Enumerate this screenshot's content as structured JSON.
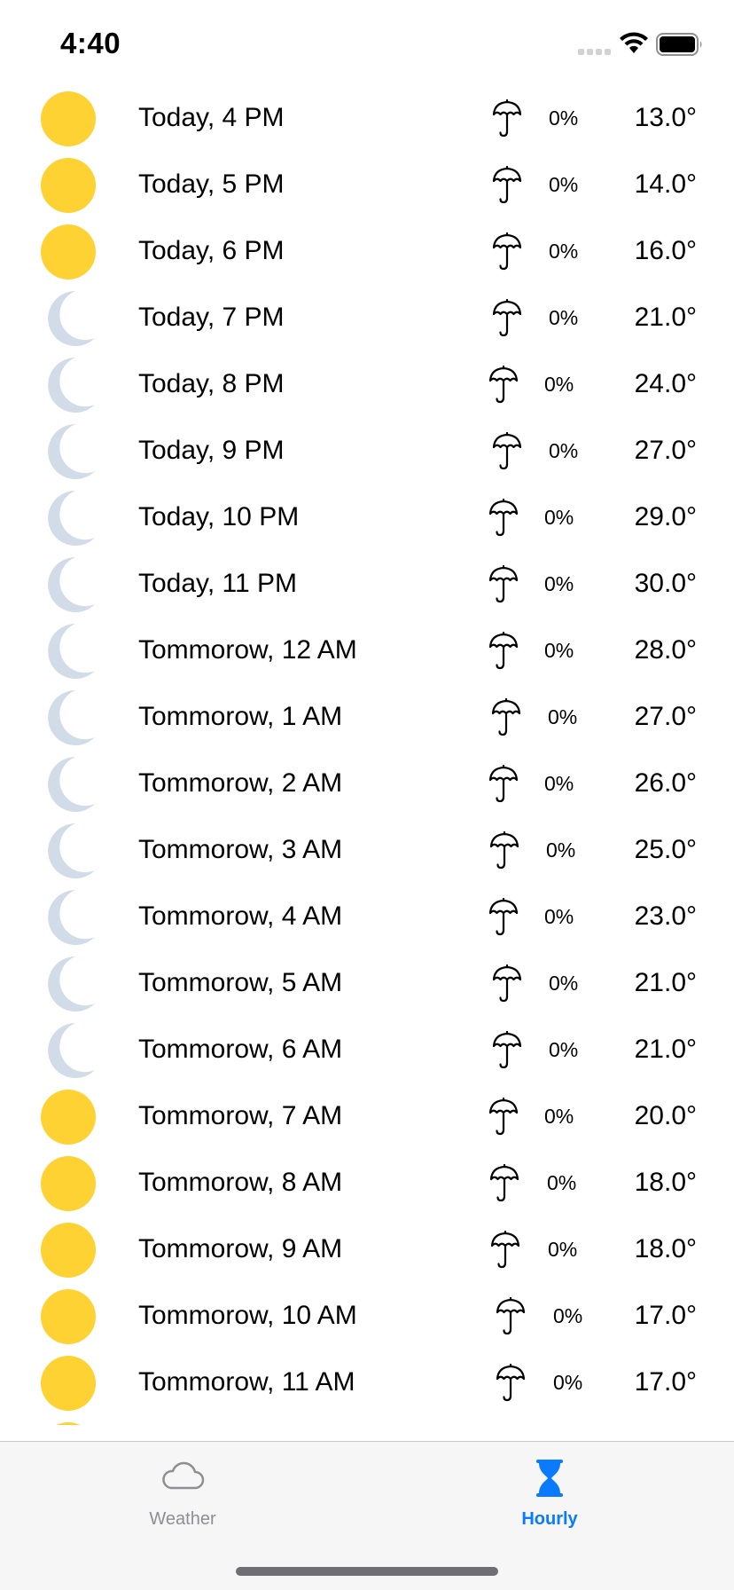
{
  "status_bar": {
    "time": "4:40"
  },
  "colors": {
    "sun": "#FFD233",
    "moon": "#D2DBE8",
    "accent": "#0A7AFF",
    "inactive": "#8E8E93"
  },
  "hourly": {
    "rows": [
      {
        "time": "Today, 4 PM",
        "icon": "sun-icon",
        "precip": "0%",
        "temp": "13.0°"
      },
      {
        "time": "Today, 5 PM",
        "icon": "sun-icon",
        "precip": "0%",
        "temp": "14.0°"
      },
      {
        "time": "Today, 6 PM",
        "icon": "sun-icon",
        "precip": "0%",
        "temp": "16.0°"
      },
      {
        "time": "Today, 7 PM",
        "icon": "moon-icon",
        "precip": "0%",
        "temp": "21.0°"
      },
      {
        "time": "Today, 8 PM",
        "icon": "moon-icon",
        "precip": "0%",
        "temp": "24.0°"
      },
      {
        "time": "Today, 9 PM",
        "icon": "moon-icon",
        "precip": "0%",
        "temp": "27.0°"
      },
      {
        "time": "Today, 10 PM",
        "icon": "moon-icon",
        "precip": "0%",
        "temp": "29.0°"
      },
      {
        "time": "Today, 11 PM",
        "icon": "moon-icon",
        "precip": "0%",
        "temp": "30.0°"
      },
      {
        "time": "Tommorow, 12 AM",
        "icon": "moon-icon",
        "precip": "0%",
        "temp": "28.0°"
      },
      {
        "time": "Tommorow, 1 AM",
        "icon": "moon-icon",
        "precip": "0%",
        "temp": "27.0°"
      },
      {
        "time": "Tommorow, 2 AM",
        "icon": "moon-icon",
        "precip": "0%",
        "temp": "26.0°"
      },
      {
        "time": "Tommorow, 3 AM",
        "icon": "moon-icon",
        "precip": "0%",
        "temp": "25.0°"
      },
      {
        "time": "Tommorow, 4 AM",
        "icon": "moon-icon",
        "precip": "0%",
        "temp": "23.0°"
      },
      {
        "time": "Tommorow, 5 AM",
        "icon": "moon-icon",
        "precip": "0%",
        "temp": "21.0°"
      },
      {
        "time": "Tommorow, 6 AM",
        "icon": "moon-icon",
        "precip": "0%",
        "temp": "21.0°"
      },
      {
        "time": "Tommorow, 7 AM",
        "icon": "sun-icon",
        "precip": "0%",
        "temp": "20.0°"
      },
      {
        "time": "Tommorow, 8 AM",
        "icon": "sun-icon",
        "precip": "0%",
        "temp": "18.0°"
      },
      {
        "time": "Tommorow, 9 AM",
        "icon": "sun-icon",
        "precip": "0%",
        "temp": "18.0°"
      },
      {
        "time": "Tommorow, 10 AM",
        "icon": "sun-icon",
        "precip": "0%",
        "temp": "17.0°"
      },
      {
        "time": "Tommorow, 11 AM",
        "icon": "sun-icon",
        "precip": "0%",
        "temp": "17.0°"
      }
    ]
  },
  "tab_bar": {
    "tabs": [
      {
        "label": "Weather",
        "icon": "cloud-icon",
        "selected": false
      },
      {
        "label": "Hourly",
        "icon": "hourglass-icon",
        "selected": true
      }
    ]
  }
}
